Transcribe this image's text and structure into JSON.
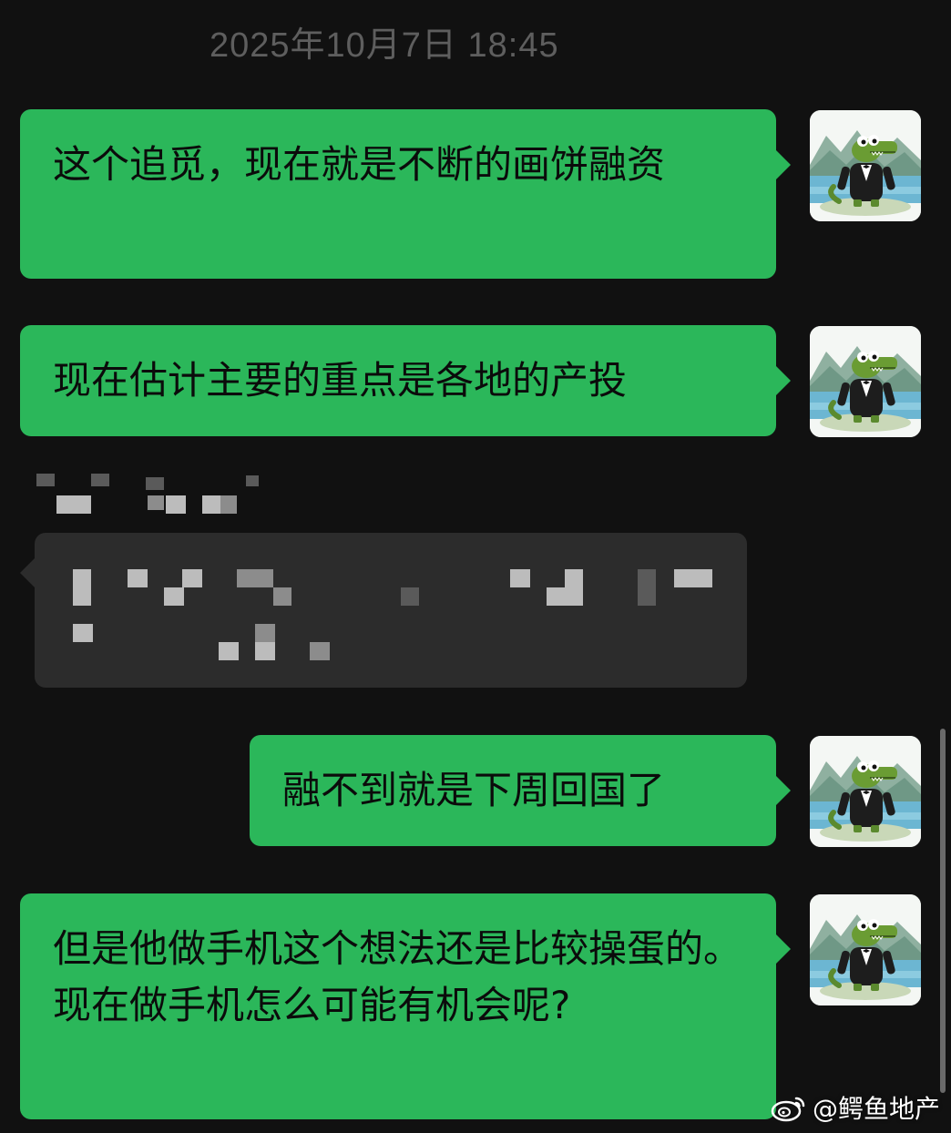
{
  "chat": {
    "timestamp": "2025年10月7日 18:45",
    "messages": [
      {
        "sender": "self",
        "text": "这个追觅，现在就是不断的画饼融资"
      },
      {
        "sender": "self",
        "text": "现在估计主要的重点是各地的产投"
      },
      {
        "sender": "other",
        "text": ""
      },
      {
        "sender": "self",
        "text": "融不到就是下周回国了"
      },
      {
        "sender": "self",
        "text": "但是他做手机这个想法还是比较操蛋的。现在做手机怎么可能有机会呢?"
      }
    ]
  },
  "watermark": {
    "text": "@鳄鱼地产",
    "icon": "weibo-icon"
  },
  "colors": {
    "background": "#111111",
    "outgoing_bubble": "#2bb75a",
    "incoming_bubble": "#2c2c2c",
    "timestamp": "#5e5e5e"
  },
  "icons": {
    "avatar": "crocodile-in-tuxedo-avatar"
  }
}
